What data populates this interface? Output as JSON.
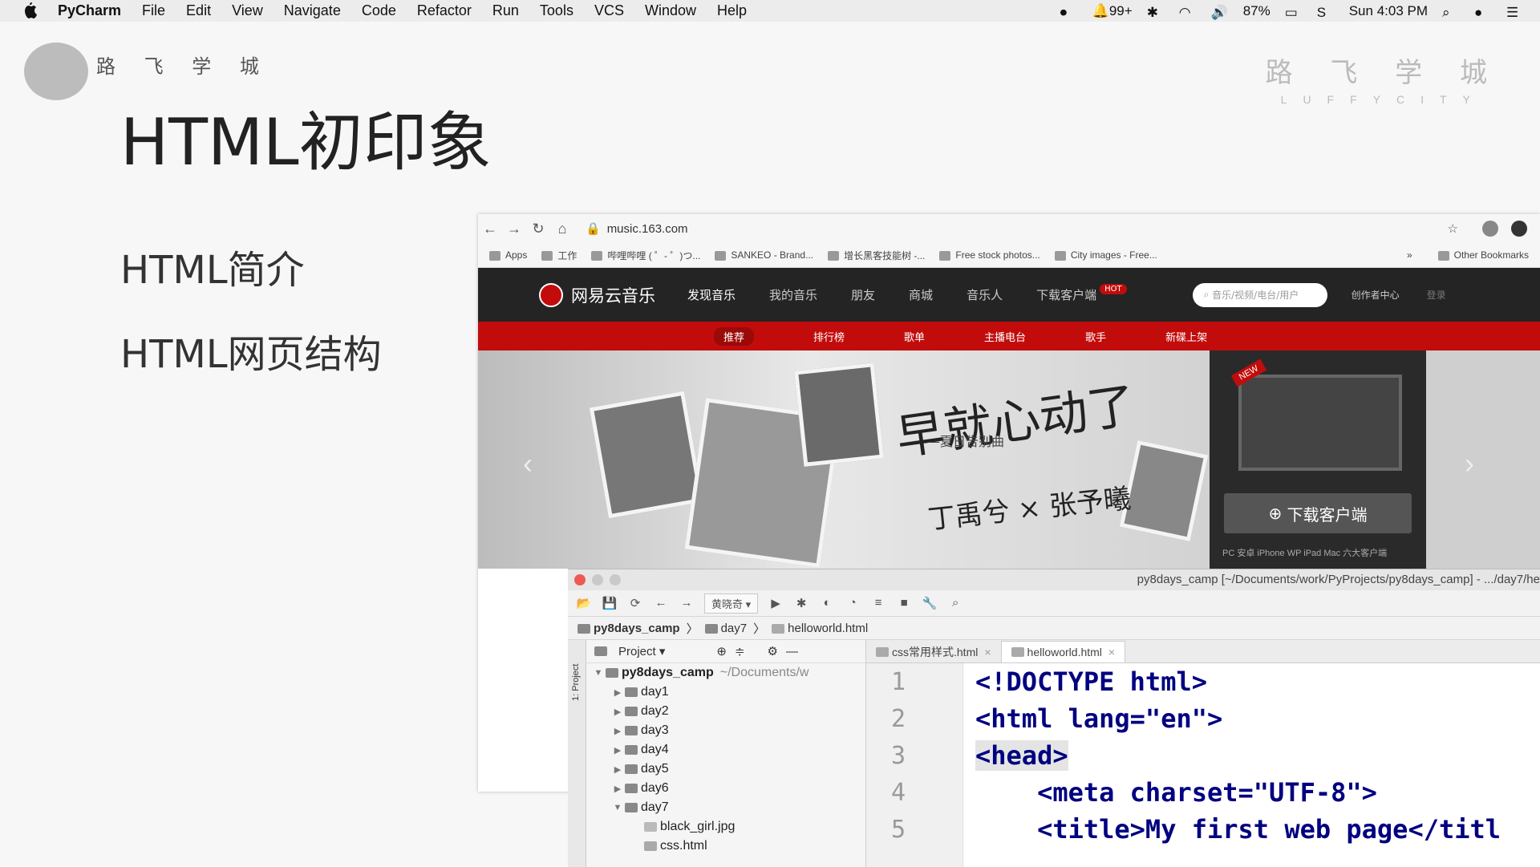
{
  "menubar": {
    "app": "PyCharm",
    "items": [
      "File",
      "Edit",
      "View",
      "Navigate",
      "Code",
      "Refactor",
      "Run",
      "Tools",
      "VCS",
      "Window",
      "Help"
    ],
    "notifications": "99+",
    "battery": "87%",
    "clock": "Sun 4:03 PM"
  },
  "slide": {
    "brand_left": "路 飞 学 城",
    "brand_right_cn": "路 飞 学 城",
    "brand_right_en": "LUFFYCITY",
    "title": "HTML初印象",
    "bullets": [
      "HTML简介",
      "HTML网页结构"
    ]
  },
  "browser": {
    "url": "music.163.com",
    "bookmarks": [
      "Apps",
      "工作",
      "哔哩哔哩 ( ゜- ゜)つ...",
      "SANKEO - Brand...",
      "增长黑客技能树 -...",
      "Free stock photos...",
      "City images - Free..."
    ],
    "bookmarks_more": "»",
    "other_bookmarks": "Other Bookmarks",
    "site": {
      "logo": "网易云音乐",
      "nav": [
        "发现音乐",
        "我的音乐",
        "朋友",
        "商城",
        "音乐人",
        "下载客户端"
      ],
      "hot_badge": "HOT",
      "search_placeholder": "音乐/视频/电台/用户",
      "creator": "创作者中心",
      "login": "登录",
      "subnav": [
        "推荐",
        "排行榜",
        "歌单",
        "主播电台",
        "歌手",
        "新碟上架"
      ],
      "banner_headline": "早就心动了",
      "banner_subhead": "—夏日告别曲",
      "banner_artists": "丁禹兮 × 张予曦",
      "new_tag": "NEW",
      "download_button": "下载客户端",
      "download_platforms": "PC 安卓 iPhone WP iPad Mac 六大客户端"
    }
  },
  "pycharm": {
    "window_title": "py8days_camp [~/Documents/work/PyProjects/py8days_camp] - .../day7/he",
    "run_config": "黄晓奇",
    "breadcrumb": [
      "py8days_camp",
      "day7",
      "helloworld.html"
    ],
    "side_label": "1: Project",
    "project_label": "Project",
    "tree": [
      {
        "name": "py8days_camp",
        "hint": "~/Documents/w",
        "expanded": true,
        "level": 0
      },
      {
        "name": "day1",
        "level": 1
      },
      {
        "name": "day2",
        "level": 1
      },
      {
        "name": "day3",
        "level": 1
      },
      {
        "name": "day4",
        "level": 1
      },
      {
        "name": "day5",
        "level": 1
      },
      {
        "name": "day6",
        "level": 1
      },
      {
        "name": "day7",
        "level": 1,
        "expanded": true
      },
      {
        "name": "black_girl.jpg",
        "level": 2
      },
      {
        "name": "css.html",
        "level": 2
      }
    ],
    "tabs": [
      "css常用样式.html",
      "helloworld.html"
    ],
    "active_tab": 1,
    "code_lines": [
      {
        "n": "1",
        "text": "<!DOCTYPE html>"
      },
      {
        "n": "2",
        "text": "<html lang=\"en\">"
      },
      {
        "n": "3",
        "text": "<head>"
      },
      {
        "n": "4",
        "text": "    <meta charset=\"UTF-8\">"
      },
      {
        "n": "5",
        "text": "    <title>My first web page</titl"
      }
    ]
  }
}
